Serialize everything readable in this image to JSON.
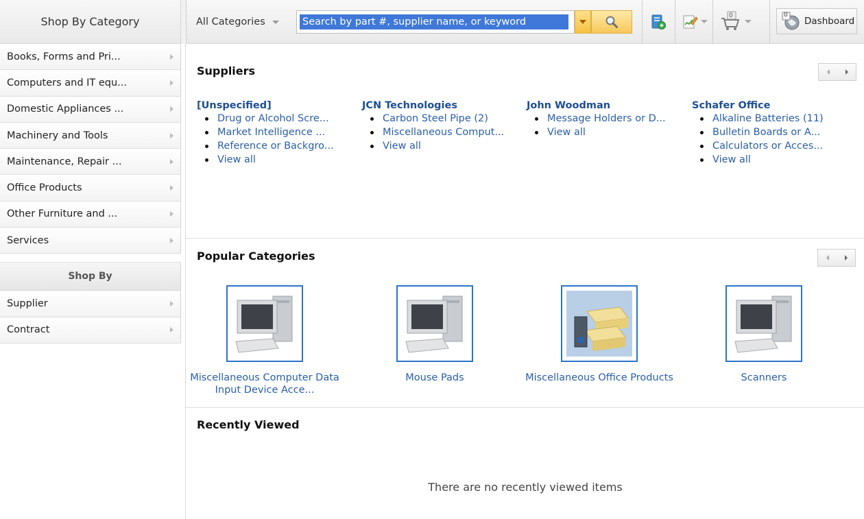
{
  "sidebar": {
    "title": "Shop By Category",
    "categories": [
      {
        "label": "Books, Forms and Pri..."
      },
      {
        "label": "Computers and IT equ..."
      },
      {
        "label": "Domestic Appliances ..."
      },
      {
        "label": "Machinery and Tools"
      },
      {
        "label": "Maintenance, Repair ..."
      },
      {
        "label": "Office Products"
      },
      {
        "label": "Other Furniture and ..."
      },
      {
        "label": "Services"
      }
    ],
    "shop_by_title": "Shop By",
    "shop_by": [
      {
        "label": "Supplier"
      },
      {
        "label": "Contract"
      }
    ]
  },
  "topbar": {
    "category_select": "All Categories",
    "search_value": "Search by part #, supplier name, or keyword",
    "cart_count": "0",
    "dashboard_count": "0",
    "dashboard_label": "Dashboard",
    "icons": [
      "new-requisition-icon",
      "edit-list-icon",
      "cart-icon",
      "dashboard-icon"
    ]
  },
  "suppliers": {
    "title": "Suppliers",
    "columns": [
      {
        "name": "[Unspecified]",
        "items": [
          "Drug or Alcohol Scre...",
          "Market Intelligence ...",
          "Reference or Backgro...",
          "View all"
        ]
      },
      {
        "name": "JCN Technologies",
        "items": [
          "Carbon Steel Pipe (2)",
          "Miscellaneous Comput...",
          "View all"
        ]
      },
      {
        "name": "John Woodman",
        "items": [
          "Message Holders or D...",
          "View all"
        ]
      },
      {
        "name": "Schafer Office",
        "items": [
          "Alkaline Batteries (11)",
          "Bulletin Boards or A...",
          "Calculators or Acces...",
          "View all"
        ]
      }
    ]
  },
  "popular": {
    "title": "Popular Categories",
    "items": [
      {
        "label": "Miscellaneous Computer Data Input Device Acce...",
        "image": "computer-image"
      },
      {
        "label": "Mouse Pads",
        "image": "computer-image"
      },
      {
        "label": "Miscellaneous Office Products",
        "image": "office-products-image"
      },
      {
        "label": "Scanners",
        "image": "computer-image"
      }
    ]
  },
  "recent": {
    "title": "Recently Viewed",
    "empty_message": "There are no recently viewed items"
  }
}
